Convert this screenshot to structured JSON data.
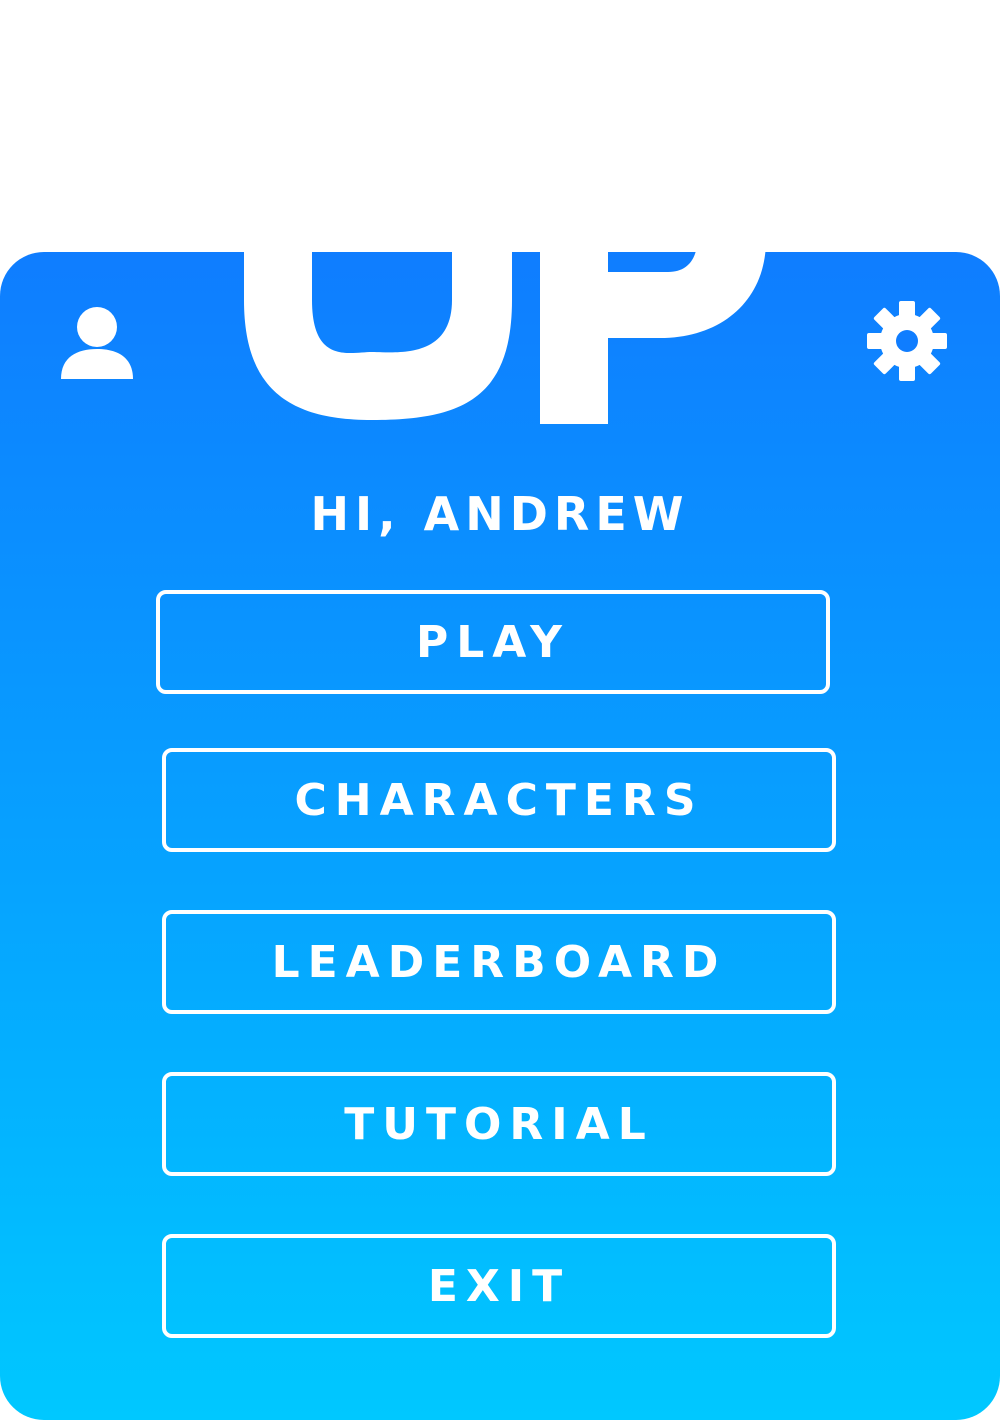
{
  "app": {
    "logo_text": "UP",
    "logo_icon": "up-arrow-logo"
  },
  "header": {
    "profile_icon": "user-icon",
    "settings_icon": "gear-icon",
    "greeting": "HI, ANDREW"
  },
  "menu": {
    "play_label": "PLAY",
    "characters_label": "CHARACTERS",
    "leaderboard_label": "LEADERBOARD",
    "tutorial_label": "TUTORIAL",
    "exit_label": "EXIT"
  },
  "colors": {
    "gradient_top": "#0f7dff",
    "gradient_bottom": "#00c8ff",
    "text": "#ffffff"
  }
}
